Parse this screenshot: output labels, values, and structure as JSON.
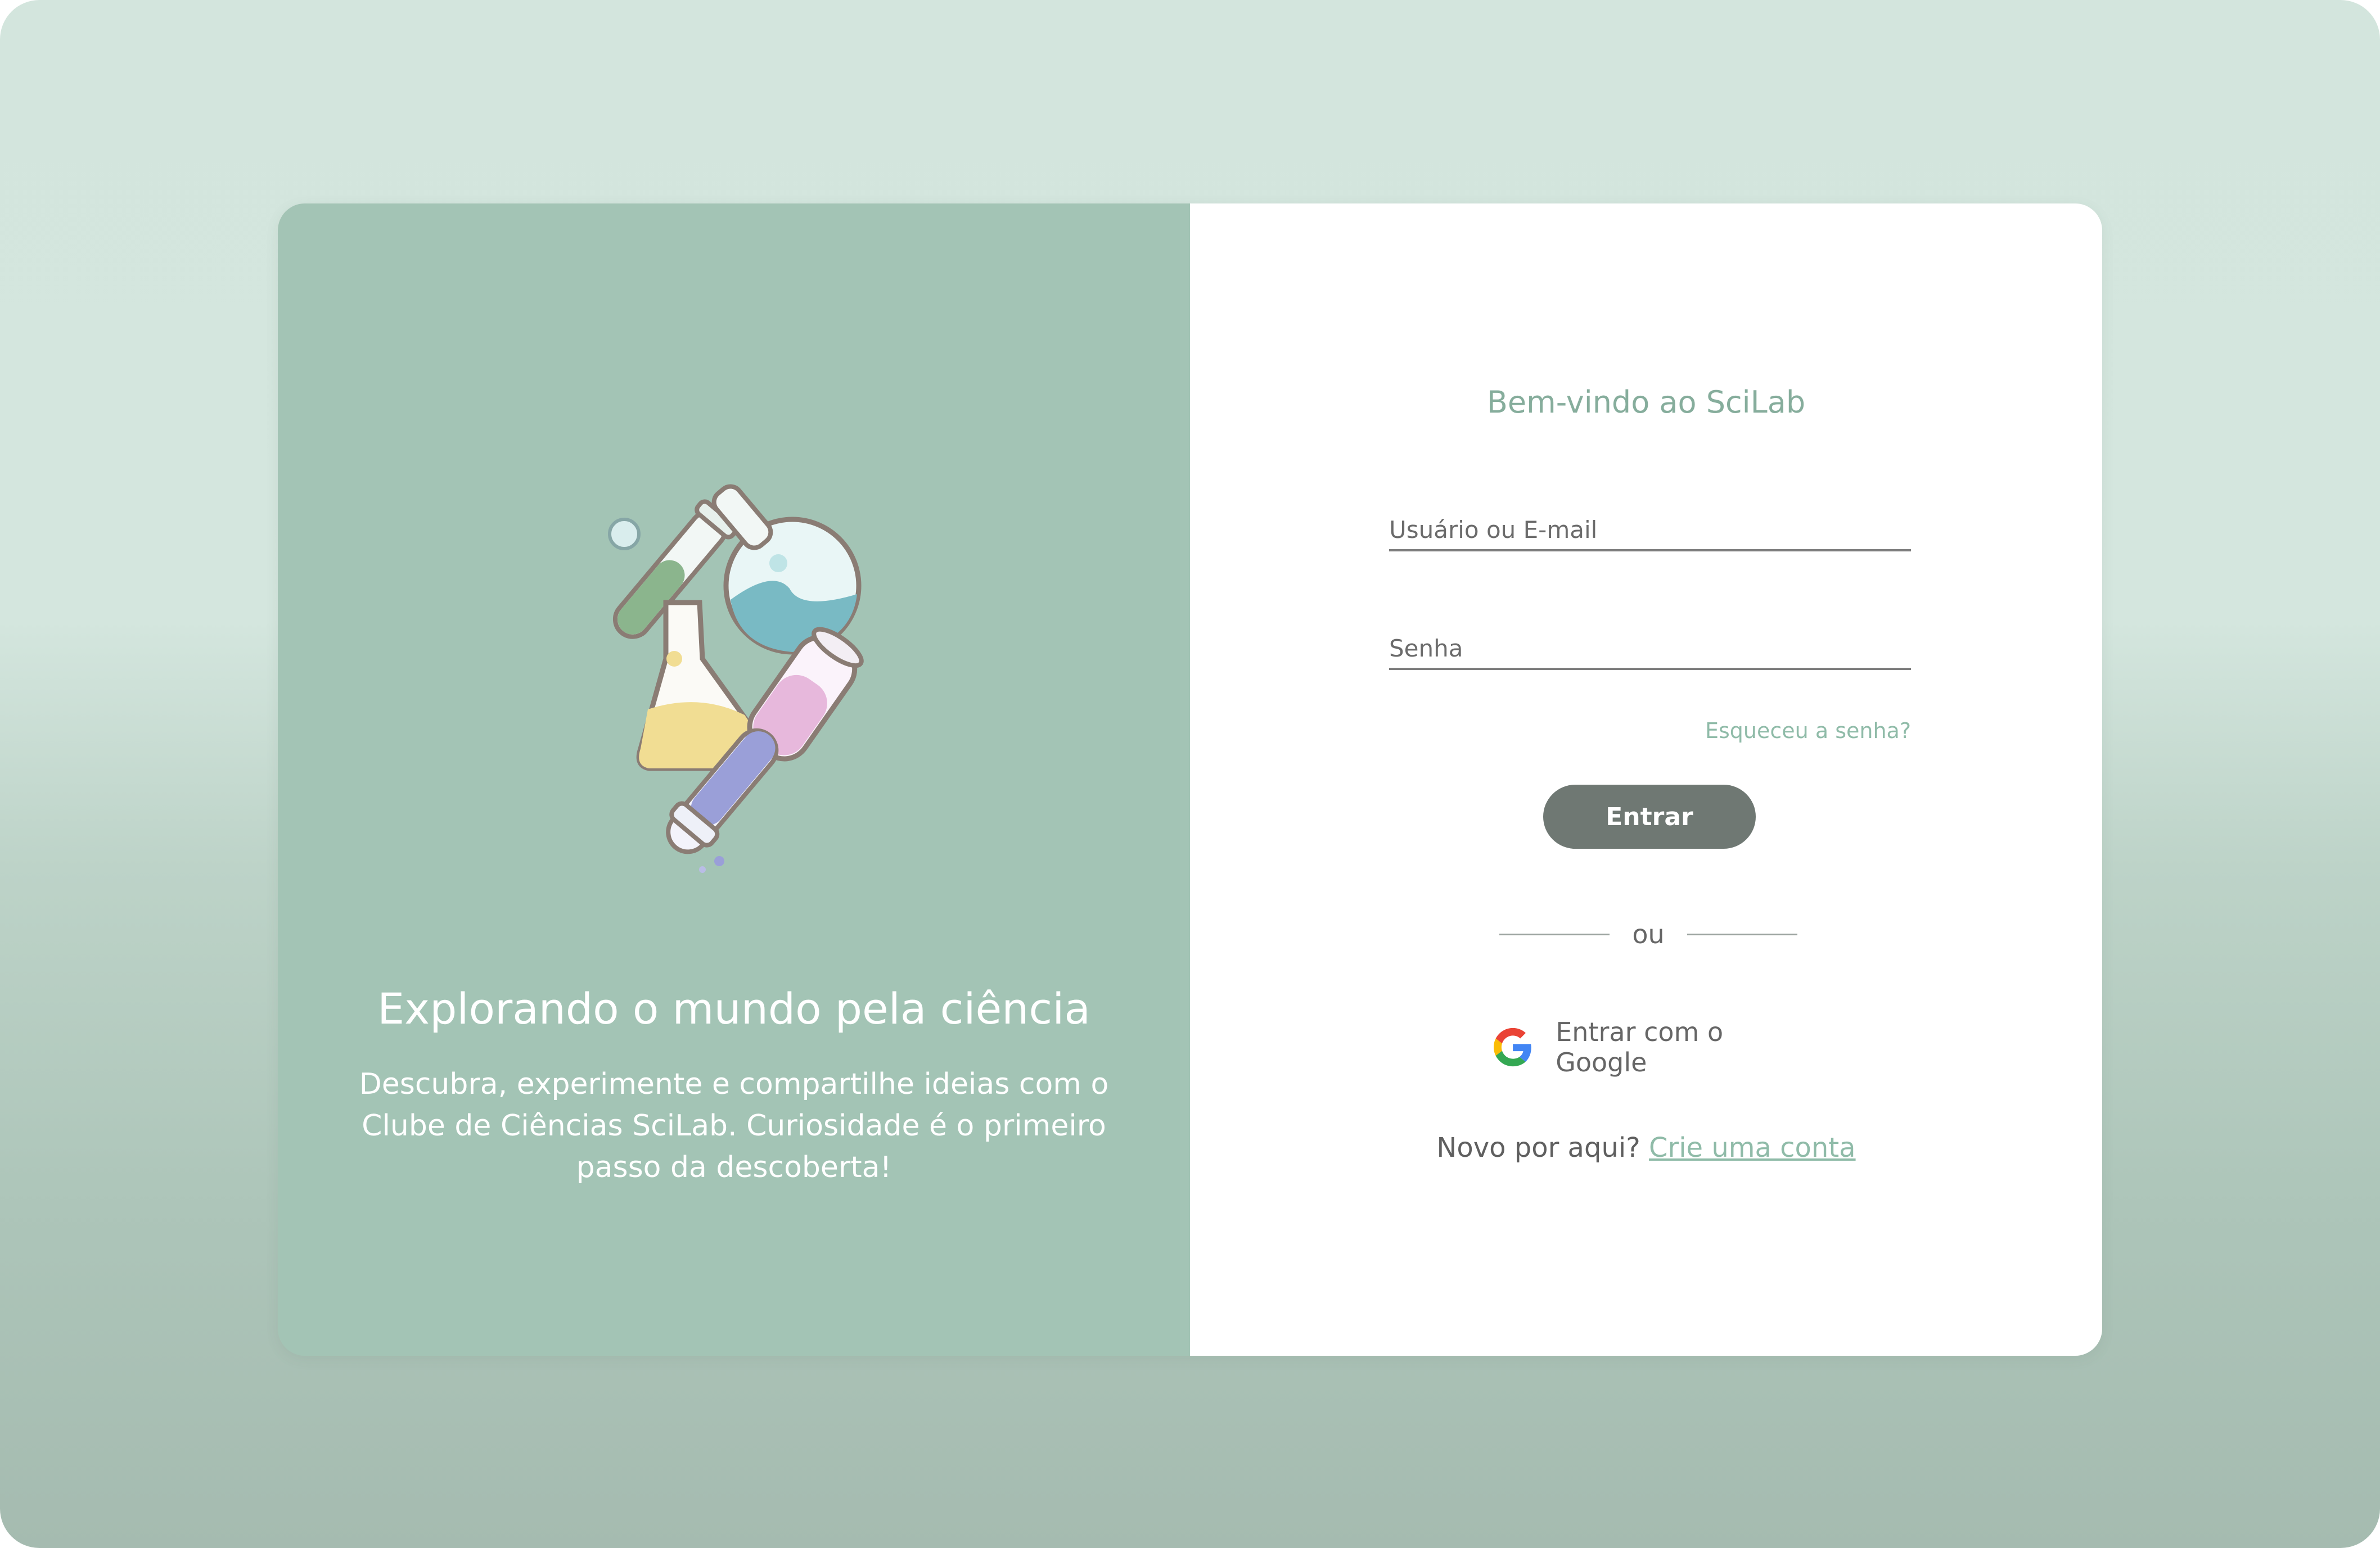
{
  "left_panel": {
    "illustration": "science-flasks-illustration",
    "title": "Explorando o mundo pela ciência",
    "description": "Descubra, experimente e compartilhe ideias com o Clube de Ciências SciLab. Curiosidade é o primeiro passo da descoberta!"
  },
  "login": {
    "welcome": "Bem-vindo ao SciLab",
    "username_placeholder": "Usuário ou E-mail",
    "password_placeholder": "Senha",
    "forgot_password": "Esqueceu a senha?",
    "submit_label": "Entrar",
    "divider_text": "ou",
    "google_label": "Entrar com o Google",
    "google_icon": "google-g-icon",
    "signup_prompt": "Novo por aqui?",
    "signup_link": "Crie uma conta"
  },
  "colors": {
    "left_panel_bg": "#a3c4b5",
    "accent_green": "#86ad9c",
    "link_green": "#8fbba8",
    "button_bg": "#6f7873",
    "page_bg_top": "#d3e5dd",
    "page_bg_bottom": "#a5bbb0"
  }
}
